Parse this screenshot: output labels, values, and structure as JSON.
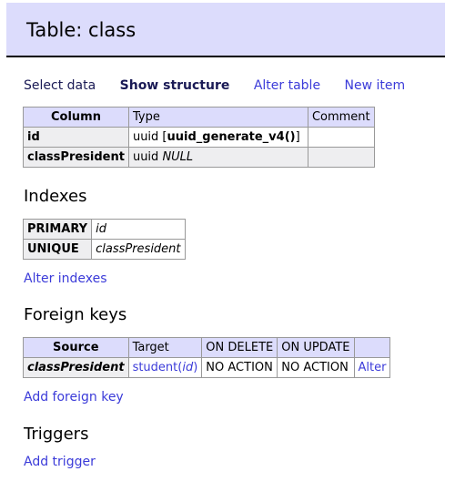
{
  "header": {
    "title": "Table: class"
  },
  "nav": {
    "select_data": "Select data",
    "show_structure": "Show structure",
    "alter_table": "Alter table",
    "new_item": "New item"
  },
  "columns_table": {
    "headers": [
      "Column",
      "Type",
      "Comment"
    ],
    "rows": [
      {
        "name": "id",
        "type_prefix": "uuid [",
        "type_default": "uuid_generate_v4()",
        "type_suffix": "]",
        "comment": ""
      },
      {
        "name": "classPresident",
        "type_prefix": "uuid ",
        "type_null": "NULL",
        "comment": ""
      }
    ]
  },
  "indexes": {
    "title": "Indexes",
    "rows": [
      {
        "type": "PRIMARY",
        "columns": "id"
      },
      {
        "type": "UNIQUE",
        "columns": "classPresident"
      }
    ],
    "alter_link": "Alter indexes"
  },
  "foreign_keys": {
    "title": "Foreign keys",
    "headers": [
      "Source",
      "Target",
      "ON DELETE",
      "ON UPDATE",
      ""
    ],
    "rows": [
      {
        "source": "classPresident",
        "target_table": "student",
        "target_column": "id",
        "on_delete": "NO ACTION",
        "on_update": "NO ACTION",
        "action": "Alter"
      }
    ],
    "add_link": "Add foreign key"
  },
  "triggers": {
    "title": "Triggers",
    "add_link": "Add trigger"
  }
}
